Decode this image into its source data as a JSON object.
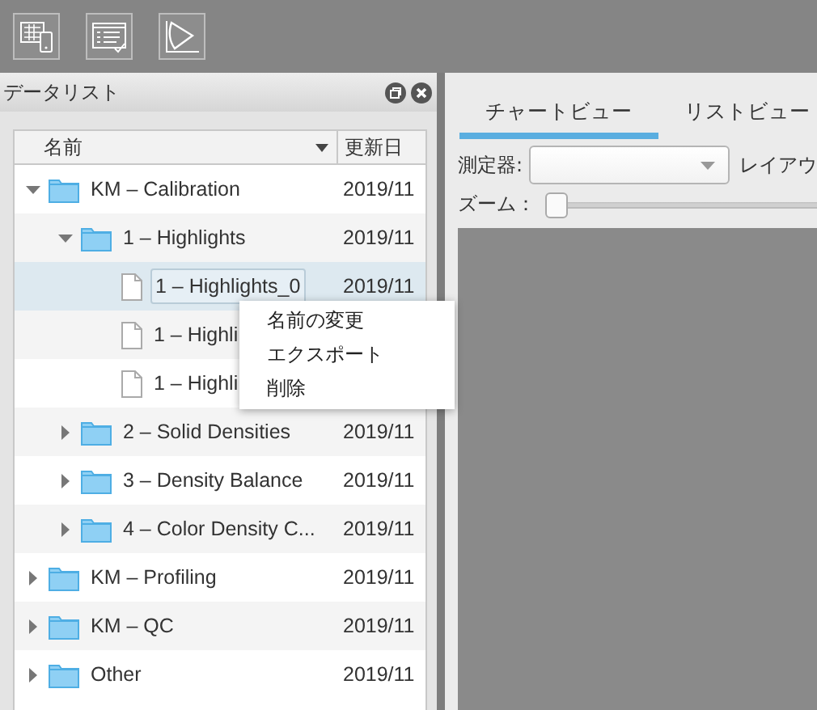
{
  "toolbar": {
    "buttons": [
      {
        "kind": "grid-device"
      },
      {
        "kind": "list-check"
      },
      {
        "kind": "gamut"
      }
    ]
  },
  "data_list": {
    "title": "データリスト",
    "columns": [
      {
        "label": "名前",
        "sorted": true
      },
      {
        "label": "更新日",
        "sorted": false
      }
    ],
    "items": [
      {
        "kind": "folder",
        "name": "KM – Calibration",
        "date": "2019/11",
        "expanded": true,
        "selected": false,
        "children": [
          {
            "kind": "folder",
            "name": "1 – Highlights",
            "date": "2019/11",
            "expanded": true,
            "selected": false,
            "children": [
              {
                "kind": "file",
                "name": "1 – Highlights_0",
                "date": "2019/11",
                "selected": true
              },
              {
                "kind": "file",
                "name": "1 – Highli",
                "selected": false
              },
              {
                "kind": "file",
                "name": "1 – Highli",
                "selected": false
              }
            ]
          },
          {
            "kind": "folder",
            "name": "2 – Solid Densities",
            "date": "2019/11",
            "expanded": false,
            "selected": false
          },
          {
            "kind": "folder",
            "name": "3 – Density Balance",
            "date": "2019/11",
            "expanded": false,
            "selected": false
          },
          {
            "kind": "folder",
            "name": "4 – Color Density C...",
            "date": "2019/11",
            "expanded": false,
            "selected": false
          }
        ]
      },
      {
        "kind": "folder",
        "name": "KM – Profiling",
        "date": "2019/11",
        "expanded": false,
        "selected": false
      },
      {
        "kind": "folder",
        "name": "KM – QC",
        "date": "2019/11",
        "expanded": false,
        "selected": false
      },
      {
        "kind": "folder",
        "name": "Other",
        "date": "2019/11",
        "expanded": false,
        "selected": false
      }
    ]
  },
  "context_menu": {
    "items": [
      "名前の変更",
      "エクスポート",
      "削除"
    ]
  },
  "viewer": {
    "tabs": [
      {
        "label": "チャートビュー",
        "selected": true
      },
      {
        "label": "リストビュー",
        "selected": false
      }
    ],
    "instrument": {
      "label": "測定器:"
    },
    "layout_label": "レイアウ",
    "zoom": {
      "label": "ズーム：",
      "level": 0
    }
  }
}
